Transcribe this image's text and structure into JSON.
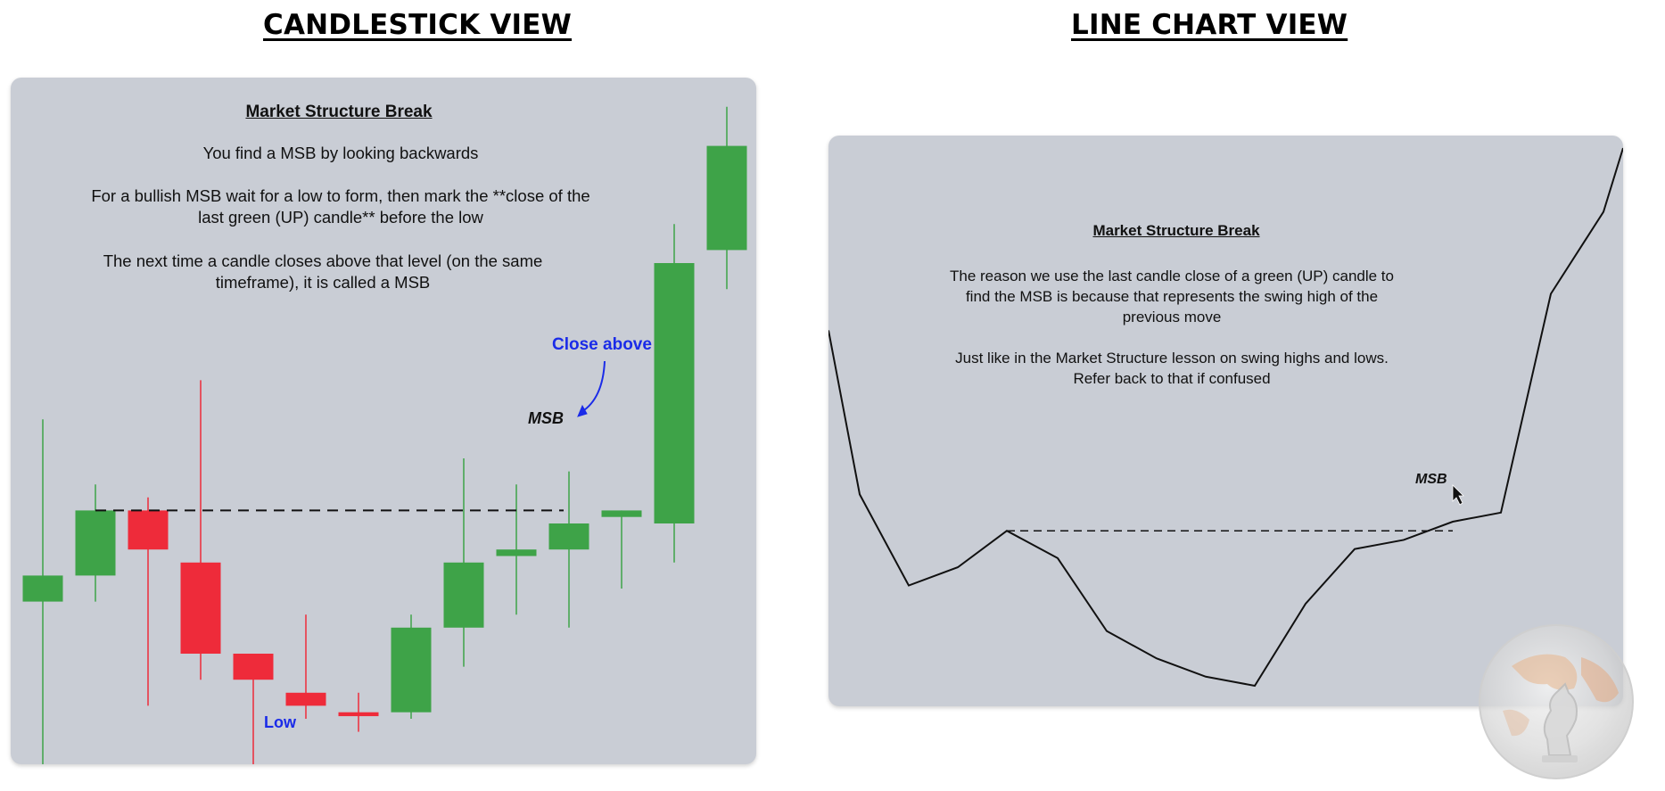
{
  "headings": {
    "left": "CANDLESTICK VIEW",
    "right": "LINE CHART VIEW"
  },
  "candlestick_panel": {
    "title": "Market Structure Break",
    "line1": "You find a MSB by looking backwards",
    "line2a": "For a bullish MSB wait for a low to form, then mark the **close of the",
    "line2b": "last green (UP) candle** before the low",
    "line3a": "The next time a candle closes above that level (on the same",
    "line3b": "timeframe), it is called a MSB",
    "msb_label": "MSB",
    "close_above_label": "Close above",
    "low_label": "Low"
  },
  "line_panel": {
    "title": "Market Structure Break",
    "line1a": "The reason we use the last candle close of a green (UP) candle to",
    "line1b": "find the MSB is because that represents the swing high of the",
    "line1c": "previous move",
    "line2a": "Just like in the Market Structure lesson on swing highs and lows.",
    "line2b": "Refer back to that if confused",
    "msb_label": "MSB"
  },
  "colors": {
    "panel_bg": "#c9cdd5",
    "up_candle": "#3ea348",
    "down_candle": "#ee2b3a",
    "annotation_blue": "#1a2be8"
  },
  "icons": {
    "logo": "globe-knight-logo-icon",
    "cursor": "mouse-pointer-icon"
  },
  "chart_data": [
    {
      "type": "candlestick",
      "candles": [
        {
          "open": 0.44,
          "close": 0.46,
          "high": 0.58,
          "low": 0.31
        },
        {
          "open": 0.46,
          "close": 0.51,
          "high": 0.53,
          "low": 0.44
        },
        {
          "open": 0.51,
          "close": 0.48,
          "high": 0.52,
          "low": 0.36
        },
        {
          "open": 0.47,
          "close": 0.4,
          "high": 0.61,
          "low": 0.38
        },
        {
          "open": 0.4,
          "close": 0.38,
          "high": 0.4,
          "low": 0.27
        },
        {
          "open": 0.37,
          "close": 0.36,
          "high": 0.43,
          "low": 0.35
        },
        {
          "open": 0.355,
          "close": 0.352,
          "high": 0.37,
          "low": 0.34
        },
        {
          "open": 0.355,
          "close": 0.42,
          "high": 0.43,
          "low": 0.35
        },
        {
          "open": 0.42,
          "close": 0.47,
          "high": 0.55,
          "low": 0.39
        },
        {
          "open": 0.475,
          "close": 0.48,
          "high": 0.53,
          "low": 0.43
        },
        {
          "open": 0.48,
          "close": 0.5,
          "high": 0.54,
          "low": 0.42
        },
        {
          "open": 0.505,
          "close": 0.51,
          "high": 0.5,
          "low": 0.45
        },
        {
          "open": 0.5,
          "close": 0.7,
          "high": 0.73,
          "low": 0.47
        },
        {
          "open": 0.71,
          "close": 0.79,
          "high": 0.82,
          "low": 0.68
        }
      ],
      "msb_level": 0.51
    },
    {
      "type": "line",
      "values": [
        0.8,
        0.62,
        0.52,
        0.54,
        0.58,
        0.55,
        0.47,
        0.44,
        0.42,
        0.41,
        0.5,
        0.56,
        0.57,
        0.59,
        0.6,
        0.84,
        0.93,
        1.0
      ],
      "msb_level": 0.58
    }
  ]
}
